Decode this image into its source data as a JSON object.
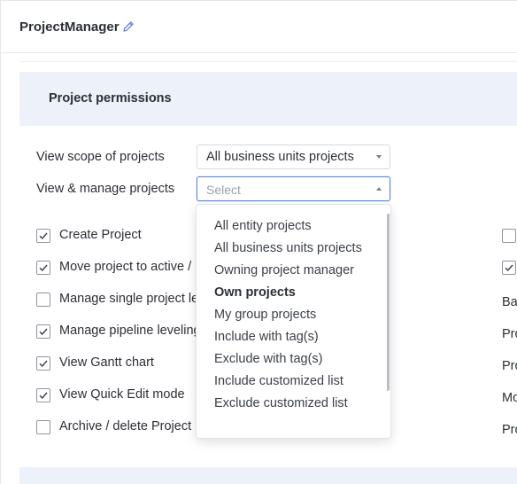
{
  "header": {
    "title": "ProjectManager",
    "edit_icon": "pencil-icon"
  },
  "section": {
    "title": "Project permissions"
  },
  "fields": {
    "view_scope": {
      "label": "View scope of projects",
      "value": "All business units projects"
    },
    "view_manage": {
      "label": "View & manage projects",
      "placeholder": "Select"
    }
  },
  "permissions": [
    {
      "label": "Create Project",
      "checked": true
    },
    {
      "label": "Move project to active /",
      "checked": true
    },
    {
      "label": "Manage single project le",
      "checked": false
    },
    {
      "label": "Manage pipeline leveling",
      "checked": true
    },
    {
      "label": "View Gantt chart",
      "checked": true
    },
    {
      "label": "View Quick Edit mode",
      "checked": true
    },
    {
      "label": "Archive / delete Project",
      "checked": false
    }
  ],
  "dropdown": {
    "options": [
      "All entity projects",
      "All business units projects",
      "Owning project manager",
      "Own projects",
      "My group projects",
      "Include with tag(s)",
      "Exclude with tag(s)",
      "Include customized list",
      "Exclude customized list"
    ],
    "highlighted": "Own projects"
  },
  "right_column": {
    "checkboxes": [
      {
        "checked": false
      },
      {
        "checked": true
      }
    ],
    "labels": [
      "Ba",
      "Pro",
      "Pro",
      "Mo",
      "Pro"
    ]
  },
  "colors": {
    "accent": "#5b86e5",
    "section_bg": "#edf1fa"
  }
}
